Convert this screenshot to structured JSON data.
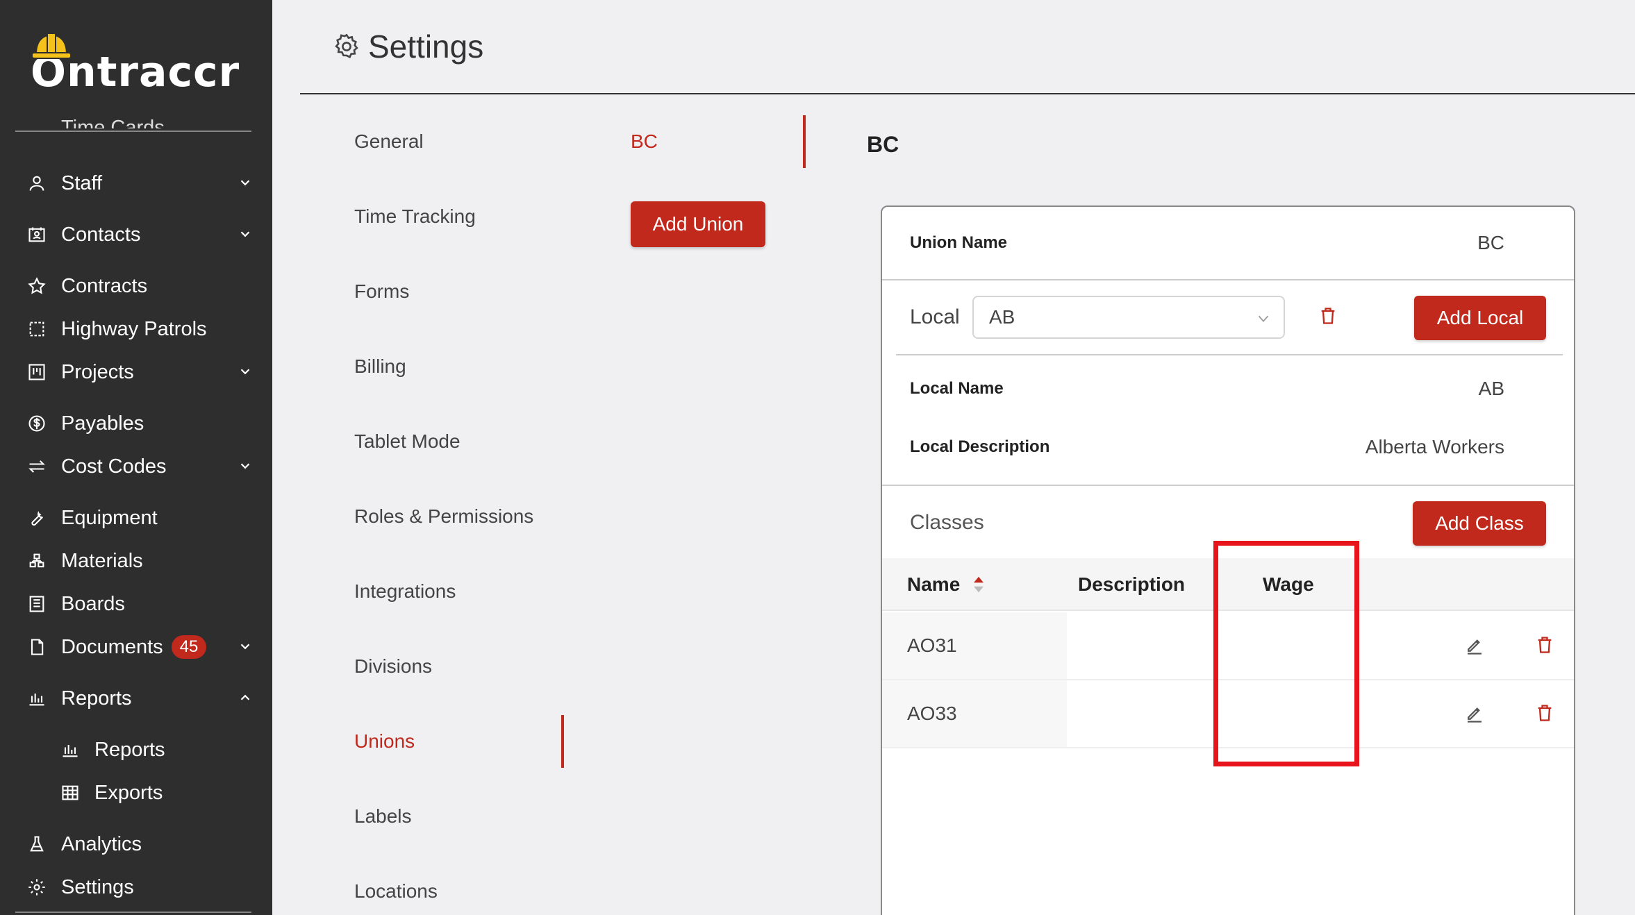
{
  "app": {
    "name": "Ontraccr",
    "brand_color": "#c0291c"
  },
  "sidebar": {
    "cut_item": "Time Cards",
    "items": [
      {
        "label": "Staff",
        "icon": "person-icon"
      },
      {
        "label": "Contacts",
        "icon": "contact-card-icon"
      },
      {
        "label": "Contracts",
        "icon": "star-icon"
      },
      {
        "label": "Highway Patrols",
        "icon": "dashed-square-icon"
      },
      {
        "label": "Projects",
        "icon": "kanban-icon"
      },
      {
        "label": "Payables",
        "icon": "dollar-icon"
      },
      {
        "label": "Cost Codes",
        "icon": "swap-icon"
      },
      {
        "label": "Equipment",
        "icon": "wrench-icon"
      },
      {
        "label": "Materials",
        "icon": "boxes-icon"
      },
      {
        "label": "Boards",
        "icon": "board-icon"
      },
      {
        "label": "Documents",
        "icon": "document-icon",
        "badge": "45"
      },
      {
        "label": "Reports",
        "icon": "bar-chart-icon"
      },
      {
        "label": "Reports",
        "icon": "bar-chart-icon"
      },
      {
        "label": "Exports",
        "icon": "table-icon"
      },
      {
        "label": "Analytics",
        "icon": "flask-icon"
      },
      {
        "label": "Settings",
        "icon": "gear-icon"
      }
    ]
  },
  "header": {
    "title": "Settings"
  },
  "settings_menu": [
    "General",
    "Time Tracking",
    "Forms",
    "Billing",
    "Tablet Mode",
    "Roles & Permissions",
    "Integrations",
    "Divisions",
    "Unions",
    "Labels",
    "Locations"
  ],
  "unions": {
    "selected": "BC",
    "add_button": "Add Union"
  },
  "detail": {
    "title": "BC",
    "union_name_label": "Union Name",
    "union_name_value": "BC",
    "local_label": "Local",
    "local_selected": "AB",
    "add_local": "Add Local",
    "local_name_label": "Local Name",
    "local_name_value": "AB",
    "local_desc_label": "Local Description",
    "local_desc_value": "Alberta Workers",
    "classes_label": "Classes",
    "add_class": "Add Class",
    "table": {
      "headers": {
        "name": "Name",
        "description": "Description",
        "wage": "Wage"
      },
      "rows": [
        {
          "name": "AO31",
          "description": "",
          "wage": ""
        },
        {
          "name": "AO33",
          "description": "",
          "wage": ""
        }
      ]
    }
  }
}
